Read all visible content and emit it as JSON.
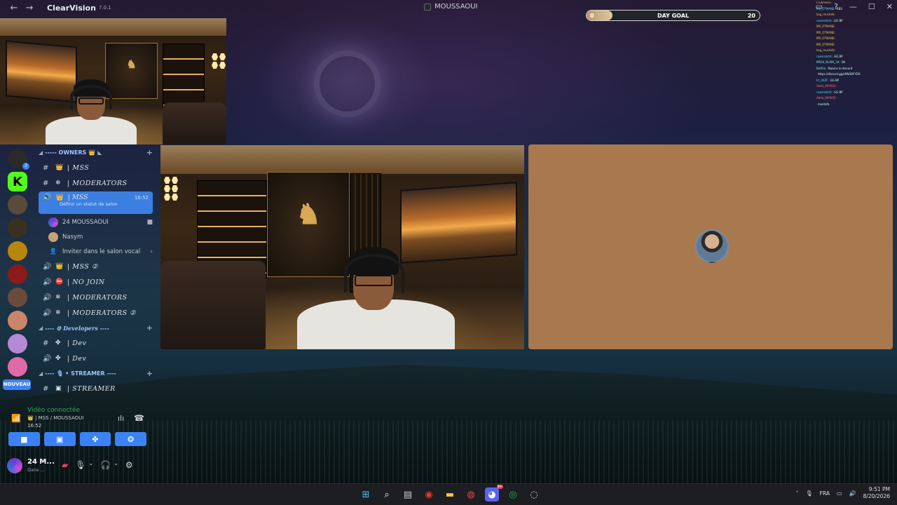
{
  "titlebar": {
    "app_name": "ClearVision",
    "app_version": "7.0.1",
    "stream_title": "MOUSSAOUI",
    "back_icon": "arrow-left-icon",
    "forward_icon": "arrow-right-icon"
  },
  "goal": {
    "label": "DAY GOAL",
    "current": "0",
    "target": "20",
    "progress_fraction": 0.15
  },
  "chat_overlay": [
    {
      "user": "I_lukmann:",
      "msg": ""
    },
    {
      "user": "MR_OTMANE:",
      "msg": "RBS"
    },
    {
      "user": "kag_mustafa:",
      "msg": ""
    },
    {
      "user": "raaminkhti:",
      "msg": "GG BP"
    },
    {
      "user": "MR_OTMANE:",
      "msg": ""
    },
    {
      "user": "MR_OTMANE:",
      "msg": ""
    },
    {
      "user": "MR_OTMANE:",
      "msg": ""
    },
    {
      "user": "MR_OTMANE:",
      "msg": ""
    },
    {
      "user": "kag_mustafa:",
      "msg": ""
    },
    {
      "user": "raaminkhti:",
      "msg": "GG BP"
    },
    {
      "user": "MR24_KLADI_34:",
      "msg": "Ok"
    },
    {
      "user": "BotRix:",
      "msg": "Rejoins le discord"
    },
    {
      "user": "",
      "msg": "https://discord.gg/zRN4DFYDX"
    },
    {
      "user": "lrt_00ZF:",
      "msg": "GG BP"
    },
    {
      "user": "Abdo_800002:",
      "msg": ""
    },
    {
      "user": "raaminkhti:",
      "msg": "GG BP"
    },
    {
      "user": "Abdo_800002:",
      "msg": ""
    },
    {
      "user": "",
      "msg": "mustafa"
    }
  ],
  "rail": {
    "servers": [
      "server-1",
      "kick-server",
      "server-3",
      "server-4",
      "server-5",
      "server-6",
      "server-7",
      "server-8",
      "server-9",
      "server-10"
    ],
    "kick_letter": "K",
    "badge_count": "2",
    "new_label": "NOUVEAU"
  },
  "channels": {
    "cat_owners": "----- OWNERS ",
    "owners": [
      {
        "icon": "#",
        "emoji": "👑",
        "name": "| MSS"
      },
      {
        "icon": "#",
        "emoji": "❄",
        "name": "| MODERATORS"
      }
    ],
    "active": {
      "icon": "🔊",
      "emoji": "👑",
      "name": "| MSS",
      "time": "16:52",
      "status": "Définir un statut de salon"
    },
    "members": [
      {
        "name": "24 MOUSSAOUI"
      },
      {
        "name": "Nasym"
      },
      {
        "name": "Inviter dans le salon vocal"
      }
    ],
    "voice_channels": [
      {
        "emoji": "👑",
        "name": "| MSS ②"
      },
      {
        "emoji": "⛔",
        "name": "| NO JOIN"
      },
      {
        "emoji": "❄",
        "name": "| MODERATORS"
      },
      {
        "emoji": "❄",
        "name": "| MODERATORS ②"
      }
    ],
    "cat_dev": "---- ⚙ Developers ----",
    "dev": [
      {
        "icon": "#",
        "emoji": "✤",
        "name": "| Dev"
      },
      {
        "icon": "🔊",
        "emoji": "✤",
        "name": "| Dev"
      }
    ],
    "cat_streamer": "---- 🎙 • STREAMER ----",
    "streamer_partial": "| STREAMER"
  },
  "voice": {
    "connected": "Vidéo connectée",
    "where": "👑 | MSS / MOUSSAOUI",
    "time": "16:52"
  },
  "user": {
    "name": "24 M...",
    "status": "Dans ..."
  },
  "taskbar": {
    "lang": "FRA",
    "time": "9:51 PM",
    "date": "8/20/2026",
    "discord_badge": "9+"
  },
  "colors": {
    "accent": "#3b82f6",
    "connected": "#3ba55d",
    "kick": "#53fc18"
  }
}
